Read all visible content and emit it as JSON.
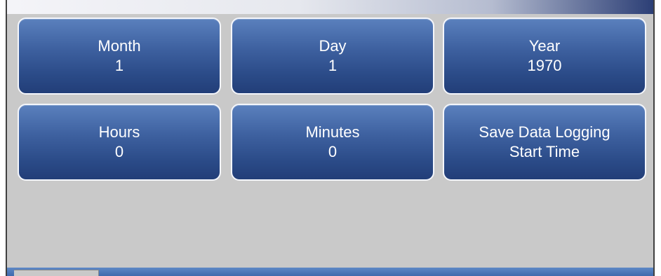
{
  "tiles": [
    {
      "label": "Month",
      "value": "1"
    },
    {
      "label": "Day",
      "value": "1"
    },
    {
      "label": "Year",
      "value": "1970"
    },
    {
      "label": "Hours",
      "value": "0"
    },
    {
      "label": "Minutes",
      "value": "0"
    },
    {
      "label": "Save Data Logging",
      "value": "Start Time"
    }
  ],
  "colors": {
    "tile_top": "#5a80bd",
    "tile_bottom": "#223e78",
    "tile_border": "#f4f6fb",
    "background": "#c9c9c9",
    "bottom_bar": "#4b75b8"
  }
}
